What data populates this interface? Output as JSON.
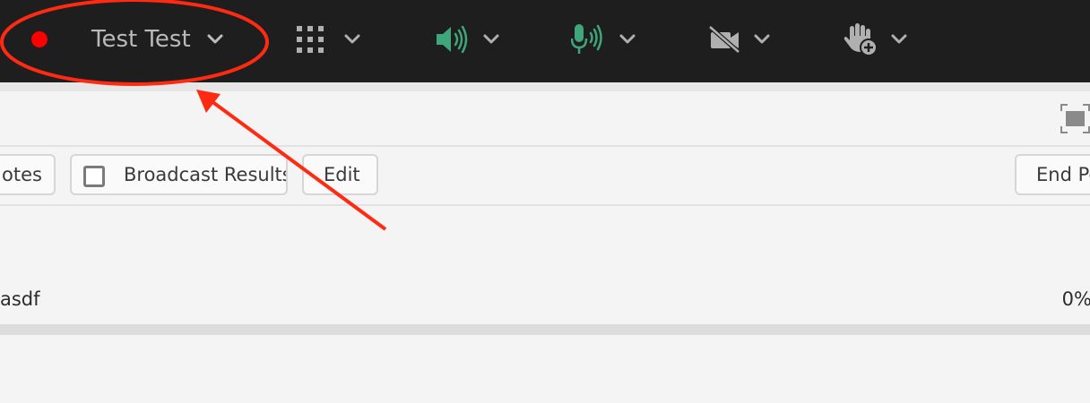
{
  "topbar": {
    "recording_color": "#ff0000",
    "user_name": "Test Test",
    "controls": [
      {
        "icon": "grid-icon",
        "color": "#b0b0b0"
      },
      {
        "icon": "speaker-icon",
        "color": "#3fa57a"
      },
      {
        "icon": "microphone-icon",
        "color": "#3fa57a"
      },
      {
        "icon": "camera-off-icon",
        "color": "#b0b0b0"
      },
      {
        "icon": "raise-hand-icon",
        "color": "#b0b0b0"
      }
    ]
  },
  "poll": {
    "buttons": {
      "notes": "otes",
      "broadcast_results": "Broadcast Results",
      "edit": "Edit",
      "end_poll": "End Po"
    },
    "answer": {
      "label": "asdf",
      "percent": "0%"
    }
  },
  "annotation": {
    "color": "#ff2a12"
  }
}
